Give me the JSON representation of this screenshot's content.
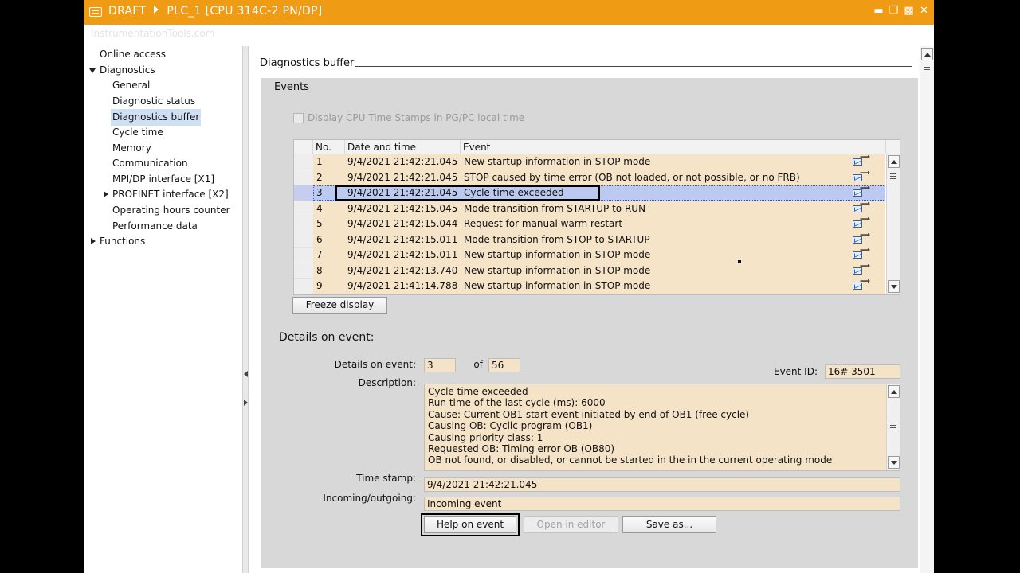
{
  "window": {
    "crumb_project": "DRAFT",
    "crumb_device": "PLC_1 [CPU 314C-2 PN/DP]",
    "watermark": "InstrumentationTools.com"
  },
  "nav": {
    "items": [
      {
        "label": "Online access",
        "level": 0,
        "arrow": "none"
      },
      {
        "label": "Diagnostics",
        "level": 0,
        "arrow": "down"
      },
      {
        "label": "General",
        "level": 1,
        "arrow": "none"
      },
      {
        "label": "Diagnostic status",
        "level": 1,
        "arrow": "none"
      },
      {
        "label": "Diagnostics buffer",
        "level": 1,
        "arrow": "none",
        "selected": true
      },
      {
        "label": "Cycle time",
        "level": 1,
        "arrow": "none"
      },
      {
        "label": "Memory",
        "level": 1,
        "arrow": "none"
      },
      {
        "label": "Communication",
        "level": 1,
        "arrow": "none"
      },
      {
        "label": "MPI/DP interface [X1]",
        "level": 1,
        "arrow": "none"
      },
      {
        "label": "PROFINET interface [X2]",
        "level": 1,
        "arrow": "right"
      },
      {
        "label": "Operating hours counter",
        "level": 1,
        "arrow": "none"
      },
      {
        "label": "Performance data",
        "level": 1,
        "arrow": "none"
      },
      {
        "label": "Functions",
        "level": 0,
        "arrow": "right"
      }
    ]
  },
  "main": {
    "section_title": "Diagnostics buffer",
    "events_title": "Events",
    "checkbox_label": "Display CPU Time Stamps in PG/PC local time",
    "table": {
      "headers": {
        "no": "No.",
        "datetime": "Date and time",
        "event": "Event"
      },
      "rows": [
        {
          "no": "1",
          "datetime": "9/4/2021 21:42:21.045",
          "event": "New startup information in STOP mode"
        },
        {
          "no": "2",
          "datetime": "9/4/2021 21:42:21.045",
          "event": "STOP caused by time error (OB not loaded, or not possible, or no FRB)"
        },
        {
          "no": "3",
          "datetime": "9/4/2021 21:42:21.045",
          "event": "Cycle time exceeded",
          "selected": true
        },
        {
          "no": "4",
          "datetime": "9/4/2021 21:42:15.045",
          "event": "Mode transition from STARTUP to RUN"
        },
        {
          "no": "5",
          "datetime": "9/4/2021 21:42:15.044",
          "event": "Request for manual warm restart"
        },
        {
          "no": "6",
          "datetime": "9/4/2021 21:42:15.011",
          "event": "Mode transition from STOP to STARTUP"
        },
        {
          "no": "7",
          "datetime": "9/4/2021 21:42:15.011",
          "event": "New startup information in STOP mode"
        },
        {
          "no": "8",
          "datetime": "9/4/2021 21:42:13.740",
          "event": "New startup information in STOP mode"
        },
        {
          "no": "9",
          "datetime": "9/4/2021 21:41:14.788",
          "event": "New startup information in STOP mode"
        }
      ]
    },
    "freeze_button": "Freeze display",
    "details": {
      "title": "Details on event:",
      "details_label": "Details on event:",
      "event_index": "3",
      "of_label": "of",
      "event_total": "56",
      "event_id_label": "Event ID:",
      "event_id": "16# 3501",
      "description_label": "Description:",
      "description_lines": [
        "Cycle time exceeded",
        "Run time of the last cycle (ms):     6000",
        "Cause: Current OB1 start event initiated by end of OB1 (free cycle)",
        "Causing OB: Cyclic program (OB1)",
        "Causing priority class:  1",
        "Requested OB: Timing error OB (OB80)",
        "OB not found, or disabled, or cannot be started in the in the current operating mode"
      ],
      "timestamp_label": "Time stamp:",
      "timestamp": "9/4/2021 21:42:21.045",
      "incoming_label": "Incoming/outgoing:",
      "incoming": "Incoming event",
      "help_button": "Help on event",
      "open_editor_button": "Open in editor",
      "save_as_button": "Save as..."
    }
  }
}
